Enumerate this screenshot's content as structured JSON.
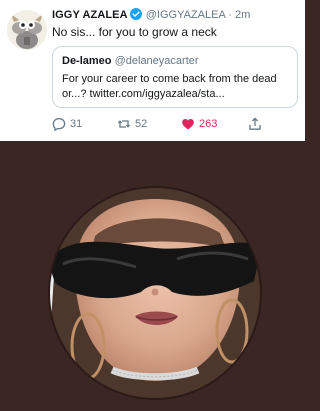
{
  "tweet": {
    "display_name": "IGGY AZALEA",
    "handle": "@IGGYAZALEA",
    "separator": "·",
    "time": "2m",
    "text": "No sis... for you to grow a neck",
    "verified_color": "#1da1f2",
    "avatar_icon": "cartoon-character-avatar"
  },
  "quote": {
    "display_name": "De-lameo",
    "handle": "@delaneyacarter",
    "text": "For your career to come back from the dead or...? twitter.com/iggyazalea/sta..."
  },
  "actions": {
    "reply_count": "31",
    "retweet_count": "52",
    "like_count": "263",
    "like_color": "#e0245e",
    "icons": [
      "reply-icon",
      "retweet-icon",
      "like-icon",
      "share-icon"
    ]
  },
  "photo": {
    "description_icon": "selfie-photo",
    "background_color": "#3a2622"
  }
}
